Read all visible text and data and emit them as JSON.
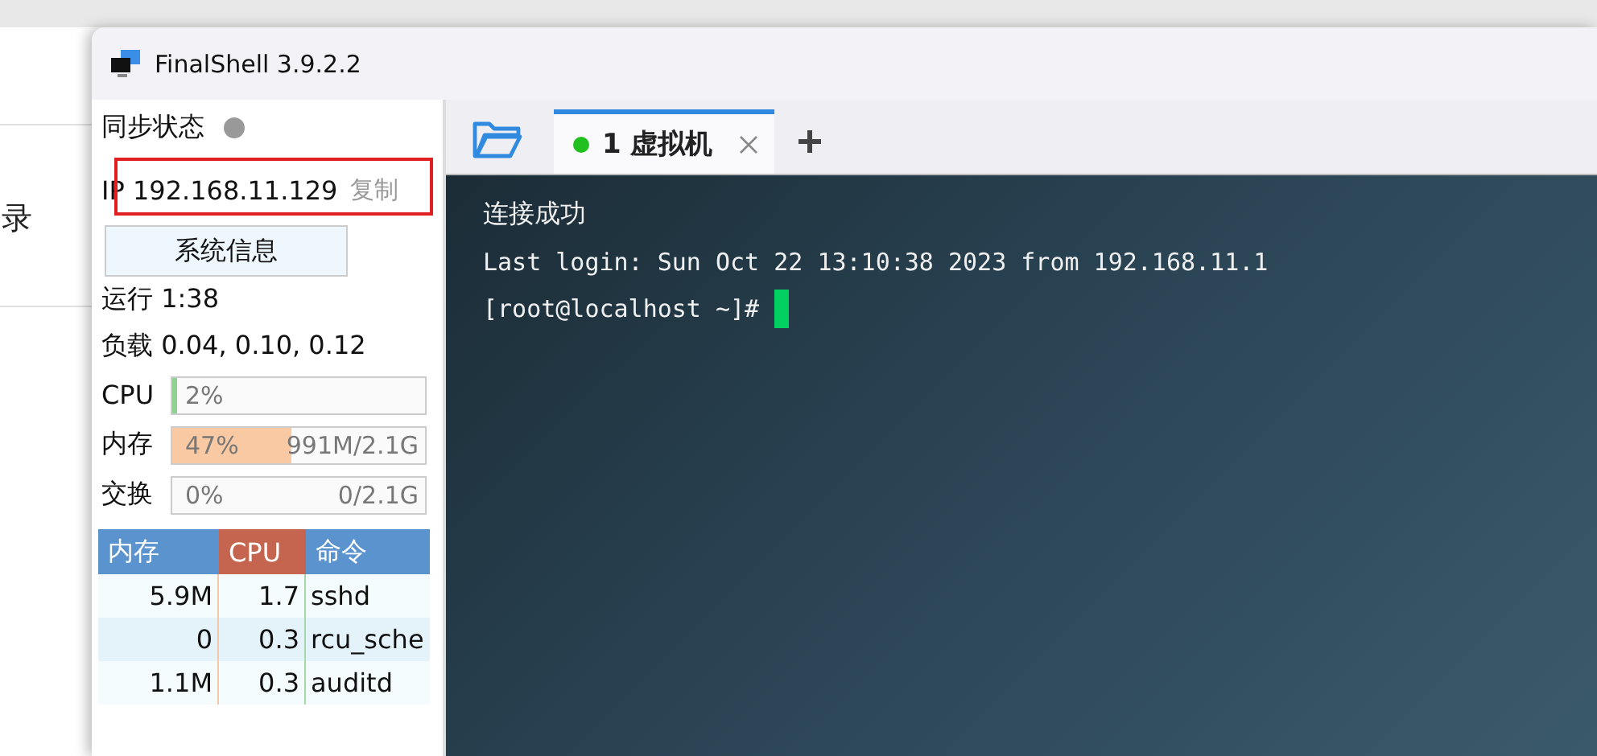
{
  "background_app": {
    "text": "录"
  },
  "window": {
    "title": "FinalShell 3.9.2.2"
  },
  "sidebar": {
    "sync": {
      "label": "同步状态",
      "synced": false
    },
    "ip": {
      "label": "IP",
      "address": "192.168.11.129",
      "copy": "复制",
      "highlighted": true
    },
    "sysinfo_button": "系统信息",
    "uptime": "运行 1:38",
    "load": "负载 0.04, 0.10, 0.12",
    "meters": [
      {
        "kind": "cpu",
        "label": "CPU",
        "level": 0.02,
        "reading": "2%"
      },
      {
        "kind": "memory",
        "label": "内存",
        "level": 0.47,
        "reading": "47%",
        "detail": "991M/2.1G"
      },
      {
        "kind": "memory",
        "label": "交换",
        "level": 0,
        "reading": "0%",
        "detail": "0/2.1G"
      }
    ],
    "process_table": {
      "columns": [
        {
          "label": "内存",
          "color": "#5b93cf"
        },
        {
          "label": "CPU",
          "color": "#c6654f"
        },
        {
          "label": "命令",
          "color": "#5b93cf"
        }
      ],
      "rows": [
        {
          "memory": "5.9M",
          "cpu": "1.7",
          "command": "sshd"
        },
        {
          "memory": "0",
          "cpu": "0.3",
          "command": "rcu_sche"
        },
        {
          "memory": "1.1M",
          "cpu": "0.3",
          "command": "auditd"
        }
      ]
    }
  },
  "tabs": [
    {
      "label": "1 虚拟机",
      "selected": true,
      "connected": true
    }
  ],
  "terminal": {
    "lines": [
      "连接成功",
      "Last login: Sun Oct 22 13:10:38 2023 from 192.168.11.1",
      "[root@localhost ~]#"
    ],
    "cursor": true
  }
}
